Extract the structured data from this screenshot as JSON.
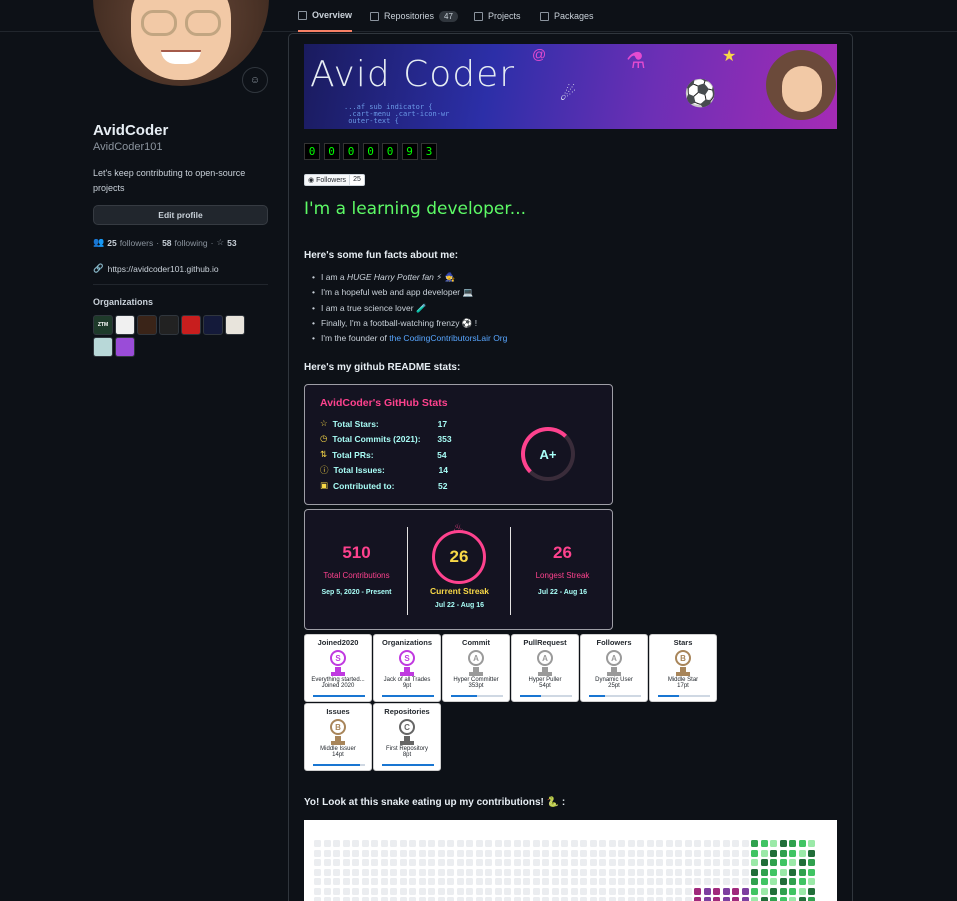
{
  "nav": {
    "tabs": [
      {
        "label": "Overview",
        "active": true
      },
      {
        "label": "Repositories",
        "count": "47"
      },
      {
        "label": "Projects"
      },
      {
        "label": "Packages"
      }
    ]
  },
  "profile": {
    "fullname": "AvidCoder",
    "username": "AvidCoder101",
    "bio": "Let's keep contributing to open-source projects",
    "edit_label": "Edit profile",
    "followers": "25",
    "followers_label": "followers",
    "following": "58",
    "following_label": "following",
    "stars": "53",
    "website": "https://avidcoder101.github.io",
    "orgs_title": "Organizations",
    "orgs": [
      {
        "name": "ZTM",
        "color": "#1e3a2a"
      },
      {
        "name": "",
        "color": "#f0f0f0"
      },
      {
        "name": "",
        "color": "#3a2418"
      },
      {
        "name": "",
        "color": "#222222"
      },
      {
        "name": "",
        "color": "#c81e1e"
      },
      {
        "name": "",
        "color": "#141a3a"
      },
      {
        "name": "",
        "color": "#e8e4dc"
      },
      {
        "name": "",
        "color": "#b8d8d8"
      },
      {
        "name": "",
        "color": "#9a4cd8"
      }
    ]
  },
  "readme": {
    "banner_title": "Avid Coder",
    "banner_code": "...af sub indicator {\n .cart-menu .cart-icon-wr\n outer-text {",
    "visitor_digits": [
      "0",
      "0",
      "0",
      "0",
      "0",
      "9",
      "3"
    ],
    "followers_badge_label": "Followers",
    "followers_badge_count": "25",
    "tagline": "I'm a learning developer...",
    "facts_heading": "Here's some fun facts about me:",
    "facts": [
      {
        "pre": "I am a ",
        "em": "HUGE Harry Potter fan",
        "post": " ⚡ 🧙"
      },
      {
        "pre": "I'm a hopeful web and app developer 💻",
        "em": "",
        "post": ""
      },
      {
        "pre": "I am a true science lover 🧪",
        "em": "",
        "post": ""
      },
      {
        "pre": "Finally, I'm a football-watching frenzy ⚽ !",
        "em": "",
        "post": ""
      }
    ],
    "founder_pre": "I'm the founder of ",
    "founder_link": "the CodingContributorsLair Org",
    "stats_heading": "Here's my github README stats:",
    "snake_heading": "Yo! Look at this snake eating up my contributions! 🐍 :"
  },
  "stats_card": {
    "title": "AvidCoder's GitHub Stats",
    "rows": [
      {
        "icon": "☆",
        "label": "Total Stars:",
        "value": "17"
      },
      {
        "icon": "◷",
        "label": "Total Commits (2021):",
        "value": "353"
      },
      {
        "icon": "⇅",
        "label": "Total PRs:",
        "value": "54"
      },
      {
        "icon": "ⓘ",
        "label": "Total Issues:",
        "value": "14"
      },
      {
        "icon": "▣",
        "label": "Contributed to:",
        "value": "52"
      }
    ],
    "grade": "A+",
    "colors": {
      "title": "#fe428e",
      "text": "#a9fef7",
      "icon": "#f8d847",
      "bg": "#141321"
    }
  },
  "streak_card": {
    "total": "510",
    "total_label": "Total Contributions",
    "total_range": "Sep 5, 2020 - Present",
    "current": "26",
    "current_label": "Current Streak",
    "current_range": "Jul 22 - Aug 16",
    "longest": "26",
    "longest_label": "Longest Streak",
    "longest_range": "Jul 22 - Aug 16"
  },
  "trophies": [
    {
      "title": "Joined2020",
      "rank": "S",
      "name": "Everything started...",
      "score": "Joined 2020",
      "color": "#c039e0",
      "progress": 1.0
    },
    {
      "title": "Organizations",
      "rank": "S",
      "name": "Jack of all Trades",
      "score": "9pt",
      "color": "#c039e0",
      "progress": 1.0
    },
    {
      "title": "Commit",
      "rank": "A",
      "name": "Hyper Committer",
      "score": "353pt",
      "color": "#9a9a9a",
      "progress": 0.5
    },
    {
      "title": "PullRequest",
      "rank": "A",
      "name": "Hyper Puller",
      "score": "54pt",
      "color": "#9a9a9a",
      "progress": 0.4
    },
    {
      "title": "Followers",
      "rank": "A",
      "name": "Dynamic User",
      "score": "25pt",
      "color": "#9a9a9a",
      "progress": 0.3
    },
    {
      "title": "Stars",
      "rank": "B",
      "name": "Middle Star",
      "score": "17pt",
      "color": "#a8855a",
      "progress": 0.4
    },
    {
      "title": "Issues",
      "rank": "B",
      "name": "Middle Issuer",
      "score": "14pt",
      "color": "#a8855a",
      "progress": 0.9
    },
    {
      "title": "Repositories",
      "rank": "C",
      "name": "First Repository",
      "score": "8pt",
      "color": "#666666",
      "progress": 1.0
    }
  ]
}
